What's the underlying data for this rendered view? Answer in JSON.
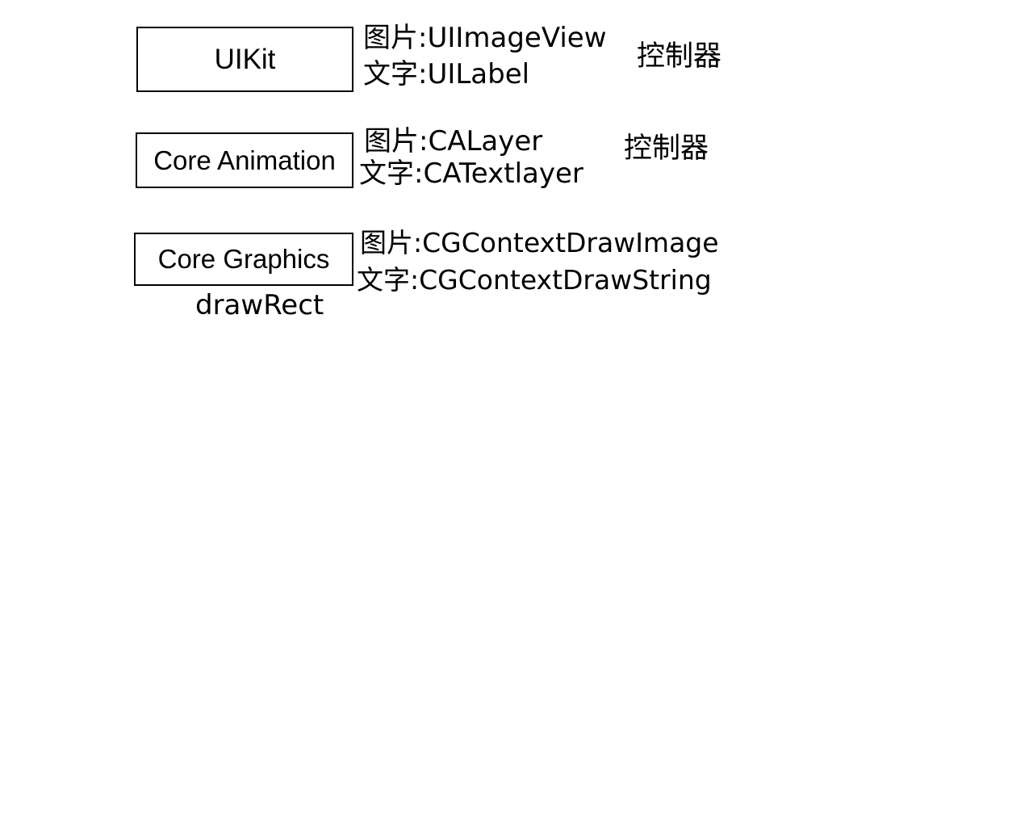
{
  "rows": [
    {
      "title": "UIKit",
      "image_line": "图片:UIImageView",
      "text_line": "文字:UILabel",
      "side_note": "控制器"
    },
    {
      "title": "Core Animation",
      "image_line": "图片:CALayer",
      "text_line": "文字:CATextlayer",
      "side_note": "控制器"
    },
    {
      "title": "Core Graphics",
      "image_line": "图片:CGContextDrawImage",
      "text_line": "文字:CGContextDrawString",
      "caption": "drawRect"
    }
  ]
}
